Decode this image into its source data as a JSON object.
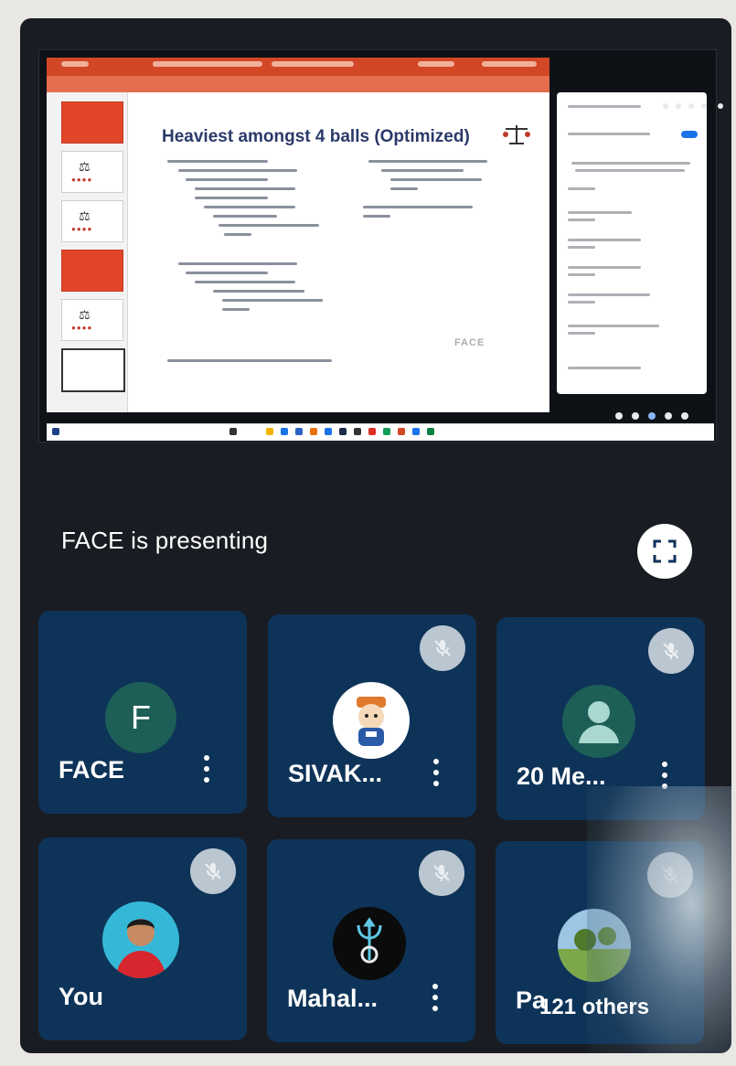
{
  "shared_screen": {
    "slide_title": "Heaviest amongst 4 balls (Optimized)",
    "slide_watermark": "FACE"
  },
  "presenting_banner": {
    "text": "FACE is presenting",
    "fullscreen_icon": "fullscreen-icon"
  },
  "participants": [
    {
      "name": "FACE",
      "initial": "F",
      "avatar": "letter-avatar",
      "muted": false,
      "has_menu": true
    },
    {
      "name": "SIVAK...",
      "avatar": "cartoon-avatar",
      "muted": true,
      "has_menu": true
    },
    {
      "name": "20 Me...",
      "avatar": "default-person-avatar",
      "muted": true,
      "has_menu": true
    },
    {
      "name": "You",
      "avatar": "photo-avatar",
      "muted": true,
      "has_menu": false
    },
    {
      "name": "Mahal...",
      "avatar": "trident-avatar",
      "muted": true,
      "has_menu": true
    },
    {
      "name": "Pa",
      "avatar": "landscape-avatar",
      "muted": true,
      "has_menu": false
    }
  ],
  "others": {
    "label": "121 others"
  },
  "colors": {
    "app_background": "#191c22",
    "tile_background": "#0e3358",
    "powerpoint_orange": "#d24726",
    "muted_badge": "#c9d3db"
  }
}
